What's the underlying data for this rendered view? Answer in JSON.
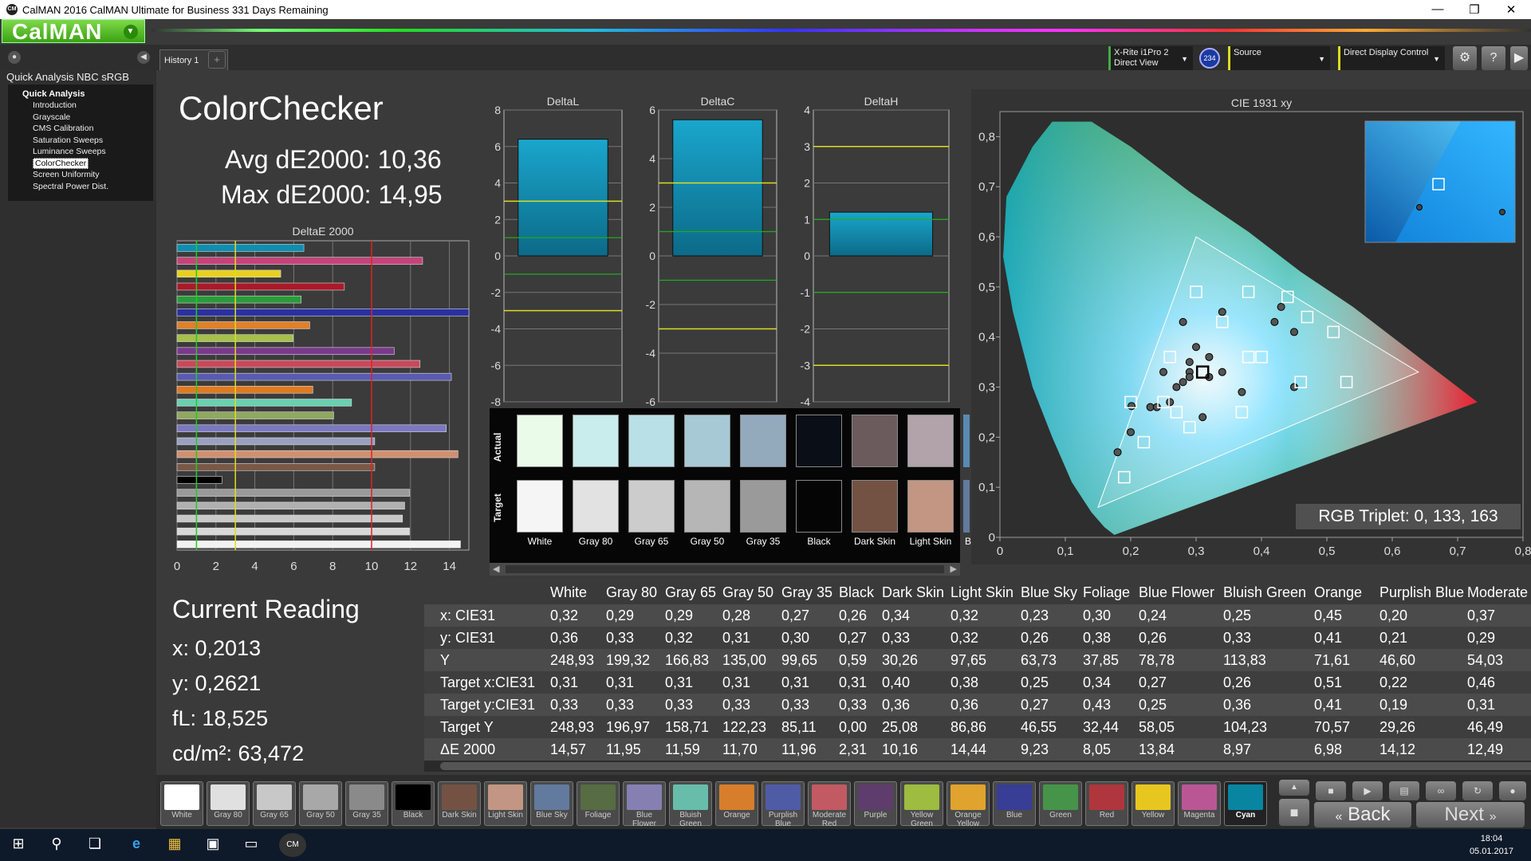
{
  "window": {
    "title": "CalMAN 2016 CalMAN Ultimate for Business 331 Days Remaining",
    "app_icon": "CM"
  },
  "logo": {
    "text": "CalMAN"
  },
  "tabs": {
    "history": "History 1",
    "add": "+"
  },
  "left_panel": {
    "title": "Quick Analysis NBC sRGB",
    "root": "Quick Analysis",
    "items": [
      "Introduction",
      "Grayscale",
      "CMS Calibration",
      "Saturation Sweeps",
      "Luminance Sweeps",
      "ColorChecker",
      "Screen Uniformity",
      "Spectral Power Dist."
    ],
    "selected": "ColorChecker"
  },
  "devices": {
    "meter_line1": "X-Rite i1Pro 2",
    "meter_line2": "Direct View",
    "meter_badge": "234",
    "source": "Source",
    "display": "Direct Display Control"
  },
  "summary": {
    "title": "ColorChecker",
    "avg": "Avg dE2000: 10,36",
    "max": "Max dE2000: 14,95"
  },
  "current_reading": {
    "title": "Current Reading",
    "x": "x: 0,2013",
    "y": "y: 0,2621",
    "fl": "fL: 18,525",
    "cd": "cd/m²: 63,472"
  },
  "colors": {
    "accent_green": "#4caf1a",
    "panel_bg": "#3a3a3a",
    "bar_teal": "#1a8fb0"
  },
  "chart_data": [
    {
      "type": "bar",
      "title": "DeltaE 2000",
      "orientation": "horizontal",
      "xlim": [
        0,
        15
      ],
      "xticks": [
        "0",
        "2",
        "4",
        "6",
        "8",
        "10",
        "12",
        "14"
      ],
      "reference_lines": [
        1,
        3,
        10
      ],
      "values": [
        6.52,
        12.62,
        5.33,
        8.6,
        6.38,
        15.0,
        6.82,
        5.97,
        11.16,
        12.49,
        14.1,
        6.98,
        8.97,
        8.05,
        13.84,
        10.16,
        14.44,
        10.16,
        2.31,
        11.96,
        11.7,
        11.59,
        11.95,
        14.57
      ],
      "bar_colors": [
        "#0e8fb0",
        "#c4447a",
        "#e8d020",
        "#a81a2a",
        "#2a9b3a",
        "#2a30a0",
        "#e0802a",
        "#a6c04a",
        "#7a3a8a",
        "#c84a5a",
        "#5a5ab0",
        "#e07a20",
        "#6ad0b0",
        "#90a860",
        "#7a78c0",
        "#9aa0c0",
        "#d09070",
        "#7a5848",
        "#000000",
        "#9a9a9a",
        "#b0b0b0",
        "#c8c8c8",
        "#d8d8d8",
        "#f2f2f2"
      ]
    },
    {
      "type": "bar",
      "title": "DeltaL",
      "ylim": [
        -8,
        8
      ],
      "yticks": [
        "8",
        "6",
        "4",
        "2",
        "0",
        "-2",
        "-4",
        "-6",
        "-8"
      ],
      "value_range": [
        0,
        6.4
      ],
      "reference_lines": {
        "yellow": [
          3,
          -3
        ],
        "green": [
          1,
          -1
        ]
      }
    },
    {
      "type": "bar",
      "title": "DeltaC",
      "ylim": [
        -6,
        6
      ],
      "yticks": [
        "6",
        "4",
        "2",
        "0",
        "-2",
        "-4",
        "-6"
      ],
      "value_range": [
        0,
        5.6
      ],
      "reference_lines": {
        "yellow": [
          3,
          -3
        ],
        "green": [
          1,
          -1
        ]
      }
    },
    {
      "type": "bar",
      "title": "DeltaH",
      "ylim": [
        -4,
        4
      ],
      "yticks": [
        "4",
        "3",
        "2",
        "1",
        "0",
        "-1",
        "-2",
        "-3",
        "-4"
      ],
      "value_range": [
        0,
        1.2
      ],
      "reference_lines": {
        "yellow": [
          3,
          -3
        ],
        "green": [
          1,
          -1
        ]
      }
    },
    {
      "type": "scatter",
      "title": "CIE 1931 xy",
      "xlim": [
        0,
        0.8
      ],
      "ylim": [
        0,
        0.85
      ],
      "xticks": [
        "0",
        "0,1",
        "0,2",
        "0,3",
        "0,4",
        "0,5",
        "0,6",
        "0,7",
        "0,8"
      ],
      "yticks": [
        "0",
        "0,1",
        "0,2",
        "0,3",
        "0,4",
        "0,5",
        "0,6",
        "0,7",
        "0,8"
      ],
      "gamut_triangle": [
        [
          0.64,
          0.33
        ],
        [
          0.3,
          0.6
        ],
        [
          0.15,
          0.06
        ]
      ],
      "targets": [
        [
          0.31,
          0.33
        ],
        [
          0.31,
          0.33
        ],
        [
          0.31,
          0.33
        ],
        [
          0.31,
          0.33
        ],
        [
          0.31,
          0.33
        ],
        [
          0.31,
          0.33
        ],
        [
          0.4,
          0.36
        ],
        [
          0.38,
          0.36
        ],
        [
          0.25,
          0.27
        ],
        [
          0.34,
          0.43
        ],
        [
          0.27,
          0.25
        ],
        [
          0.26,
          0.36
        ],
        [
          0.51,
          0.41
        ],
        [
          0.22,
          0.19
        ],
        [
          0.46,
          0.31
        ],
        [
          0.29,
          0.22
        ],
        [
          0.38,
          0.49
        ],
        [
          0.47,
          0.44
        ],
        [
          0.19,
          0.12
        ],
        [
          0.3,
          0.49
        ],
        [
          0.53,
          0.31
        ],
        [
          0.44,
          0.48
        ],
        [
          0.37,
          0.25
        ],
        [
          0.2,
          0.27
        ]
      ],
      "measured": [
        [
          0.32,
          0.36
        ],
        [
          0.29,
          0.33
        ],
        [
          0.29,
          0.32
        ],
        [
          0.28,
          0.31
        ],
        [
          0.27,
          0.3
        ],
        [
          0.26,
          0.27
        ],
        [
          0.34,
          0.33
        ],
        [
          0.32,
          0.32
        ],
        [
          0.23,
          0.26
        ],
        [
          0.3,
          0.38
        ],
        [
          0.24,
          0.26
        ],
        [
          0.25,
          0.33
        ],
        [
          0.45,
          0.41
        ],
        [
          0.2,
          0.21
        ],
        [
          0.37,
          0.29
        ],
        [
          0.29,
          0.35
        ],
        [
          0.34,
          0.45
        ],
        [
          0.42,
          0.43
        ],
        [
          0.18,
          0.17
        ],
        [
          0.28,
          0.43
        ],
        [
          0.45,
          0.3
        ],
        [
          0.43,
          0.46
        ],
        [
          0.31,
          0.24
        ],
        [
          0.2013,
          0.2621
        ]
      ],
      "current_target": [
        0.31,
        0.33
      ],
      "readout": "RGB Triplet: 0, 133, 163"
    },
    {
      "type": "table",
      "columns": [
        "",
        "White",
        "Gray 80",
        "Gray 65",
        "Gray 50",
        "Gray 35",
        "Black",
        "Dark Skin",
        "Light Skin",
        "Blue Sky",
        "Foliage",
        "Blue Flower",
        "Bluish Green",
        "Orange",
        "Purplish Blue",
        "Moderate"
      ],
      "rows": [
        [
          "x: CIE31",
          "0,32",
          "0,29",
          "0,29",
          "0,28",
          "0,27",
          "0,26",
          "0,34",
          "0,32",
          "0,23",
          "0,30",
          "0,24",
          "0,25",
          "0,45",
          "0,20",
          "0,37"
        ],
        [
          "y: CIE31",
          "0,36",
          "0,33",
          "0,32",
          "0,31",
          "0,30",
          "0,27",
          "0,33",
          "0,32",
          "0,26",
          "0,38",
          "0,26",
          "0,33",
          "0,41",
          "0,21",
          "0,29"
        ],
        [
          "Y",
          "248,93",
          "199,32",
          "166,83",
          "135,00",
          "99,65",
          "0,59",
          "30,26",
          "97,65",
          "63,73",
          "37,85",
          "78,78",
          "113,83",
          "71,61",
          "46,60",
          "54,03"
        ],
        [
          "Target x:CIE31",
          "0,31",
          "0,31",
          "0,31",
          "0,31",
          "0,31",
          "0,31",
          "0,40",
          "0,38",
          "0,25",
          "0,34",
          "0,27",
          "0,26",
          "0,51",
          "0,22",
          "0,46"
        ],
        [
          "Target y:CIE31",
          "0,33",
          "0,33",
          "0,33",
          "0,33",
          "0,33",
          "0,33",
          "0,36",
          "0,36",
          "0,27",
          "0,43",
          "0,25",
          "0,36",
          "0,41",
          "0,19",
          "0,31"
        ],
        [
          "Target Y",
          "248,93",
          "196,97",
          "158,71",
          "122,23",
          "85,11",
          "0,00",
          "25,08",
          "86,86",
          "46,55",
          "32,44",
          "58,05",
          "104,23",
          "70,57",
          "29,26",
          "46,49"
        ],
        [
          "ΔE 2000",
          "14,57",
          "11,95",
          "11,59",
          "11,70",
          "11,96",
          "2,31",
          "10,16",
          "14,44",
          "9,23",
          "8,05",
          "13,84",
          "8,97",
          "6,98",
          "14,12",
          "12,49"
        ]
      ]
    }
  ],
  "swatches": {
    "row_labels": [
      "Actual",
      "Target"
    ],
    "items": [
      {
        "label": "White",
        "actual": "#eafbea",
        "target": "#f5f5f5"
      },
      {
        "label": "Gray 80",
        "actual": "#c9ecec",
        "target": "#e2e2e2"
      },
      {
        "label": "Gray 65",
        "actual": "#b9e0e6",
        "target": "#cccccc"
      },
      {
        "label": "Gray 50",
        "actual": "#a7c9d6",
        "target": "#b6b6b6"
      },
      {
        "label": "Gray 35",
        "actual": "#93aabd",
        "target": "#9a9a9a"
      },
      {
        "label": "Black",
        "actual": "#0a0e16",
        "target": "#050505"
      },
      {
        "label": "Dark Skin",
        "actual": "#6b5b5c",
        "target": "#735244"
      },
      {
        "label": "Light Skin",
        "actual": "#b1a3a9",
        "target": "#c29682"
      }
    ],
    "partial": {
      "label": "B",
      "actual": "#5a8ab0",
      "target": "#627a9d"
    }
  },
  "bottom_tiles": [
    {
      "label": "White",
      "color": "#ffffff"
    },
    {
      "label": "Gray 80",
      "color": "#e0e0e0"
    },
    {
      "label": "Gray 65",
      "color": "#c8c8c8"
    },
    {
      "label": "Gray 50",
      "color": "#a8a8a8"
    },
    {
      "label": "Gray 35",
      "color": "#8a8a8a"
    },
    {
      "label": "Black",
      "color": "#000000"
    },
    {
      "label": "Dark Skin",
      "color": "#735244"
    },
    {
      "label": "Light Skin",
      "color": "#c29682"
    },
    {
      "label": "Blue Sky",
      "color": "#627a9d"
    },
    {
      "label": "Foliage",
      "color": "#576c43"
    },
    {
      "label": "Blue Flower",
      "color": "#8580b1"
    },
    {
      "label": "Bluish Green",
      "color": "#67bdaa"
    },
    {
      "label": "Orange",
      "color": "#d67e2c"
    },
    {
      "label": "Purplish Blue",
      "color": "#505ba6"
    },
    {
      "label": "Moderate Red",
      "color": "#c15a63"
    },
    {
      "label": "Purple",
      "color": "#5e3c6c"
    },
    {
      "label": "Yellow Green",
      "color": "#9dbc40"
    },
    {
      "label": "Orange Yellow",
      "color": "#e0a32e"
    },
    {
      "label": "Blue",
      "color": "#383d96"
    },
    {
      "label": "Green",
      "color": "#469449"
    },
    {
      "label": "Red",
      "color": "#af363c"
    },
    {
      "label": "Yellow",
      "color": "#e7c71f"
    },
    {
      "label": "Magenta",
      "color": "#bb5695"
    },
    {
      "label": "Cyan",
      "color": "#0885a1"
    }
  ],
  "current_tile": "Cyan",
  "navigation": {
    "back": "Back",
    "next": "Next"
  },
  "taskbar": {
    "time": "18:04",
    "date": "05.01.2017"
  }
}
